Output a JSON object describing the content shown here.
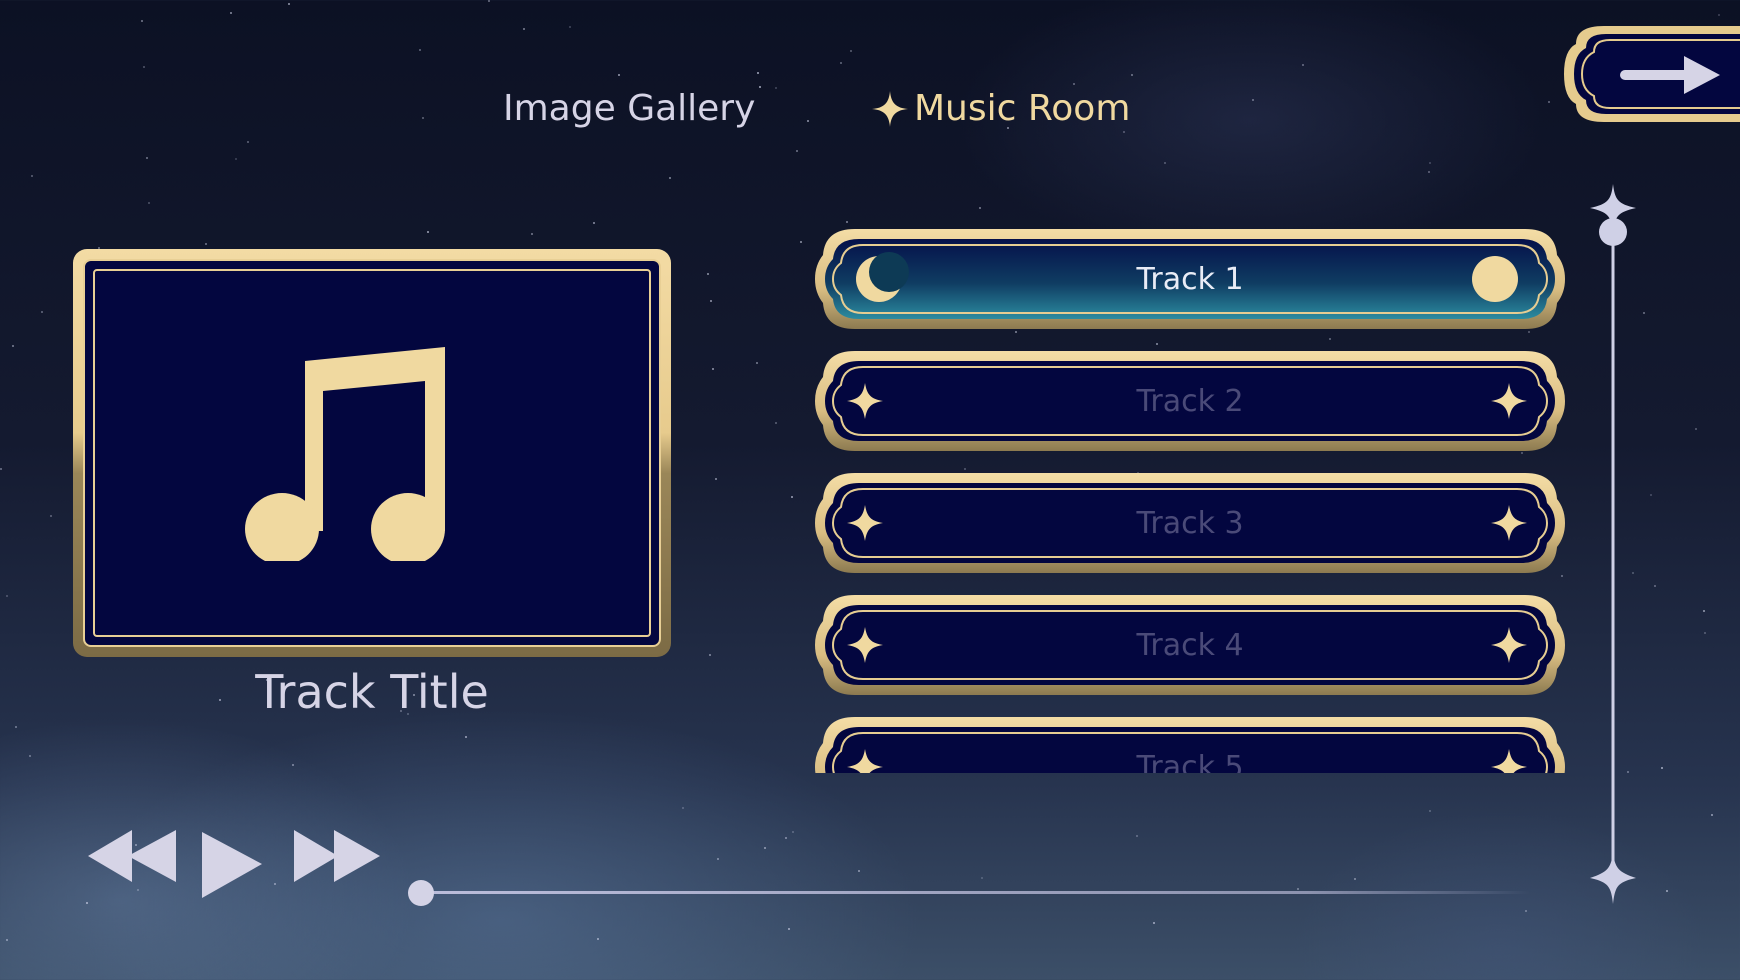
{
  "nav": {
    "tabs": [
      {
        "label": "Image Gallery",
        "active": false
      },
      {
        "label": "Music Room",
        "active": true
      }
    ]
  },
  "now_playing": {
    "title": "Track Title",
    "cover_icon": "music-note-icon",
    "progress": 0
  },
  "tracks": [
    {
      "label": "Track 1",
      "active": true
    },
    {
      "label": "Track 2",
      "active": false
    },
    {
      "label": "Track 3",
      "active": false
    },
    {
      "label": "Track 4",
      "active": false
    },
    {
      "label": "Track 5",
      "active": false
    }
  ],
  "controls": {
    "rewind_icon": "rewind-icon",
    "play_icon": "play-icon",
    "fast_forward_icon": "fast-forward-icon",
    "exit_icon": "arrow-right-icon"
  },
  "colors": {
    "gold": "#f0d9a0",
    "navy": "#03063f",
    "text_light": "#d6d4e6",
    "inactive_text": "#4a4a78"
  }
}
